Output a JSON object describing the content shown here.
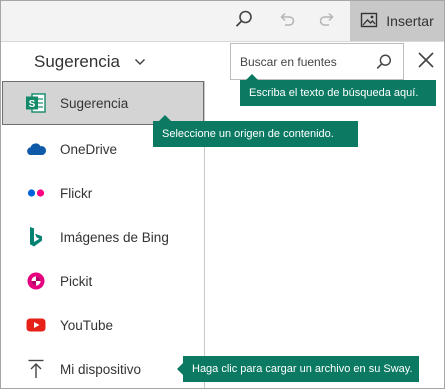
{
  "toolbar": {
    "insert_label": "Insertar",
    "icons": [
      "search-icon",
      "undo-icon",
      "redo-icon",
      "image-icon"
    ]
  },
  "source_dropdown": {
    "selected": "Sugerencia"
  },
  "search": {
    "placeholder": "Buscar en fuentes"
  },
  "menu": {
    "items": [
      {
        "label": "Sugerencia",
        "icon": "sway-suggestion-icon",
        "selected": true
      },
      {
        "label": "OneDrive",
        "icon": "onedrive-icon"
      },
      {
        "label": "Flickr",
        "icon": "flickr-icon"
      },
      {
        "label": "Imágenes de Bing",
        "icon": "bing-icon"
      },
      {
        "label": "Pickit",
        "icon": "pickit-icon"
      },
      {
        "label": "YouTube",
        "icon": "youtube-icon"
      },
      {
        "label": "Mi dispositivo",
        "icon": "upload-icon"
      }
    ]
  },
  "tooltips": {
    "search": "Escriba el texto de búsqueda aquí.",
    "source": "Seleccione un origen de contenido.",
    "upload": "Haga clic para cargar un archivo en su Sway."
  },
  "colors": {
    "tooltip_bg": "#0c7a63",
    "sway_green": "#138a6a",
    "onedrive_blue": "#0f5aa8",
    "flickr_blue": "#0063dc",
    "flickr_pink": "#ff0084",
    "bing_teal": "#008373",
    "pickit_pink": "#e6007e",
    "youtube_red": "#e62117",
    "toolbar_bg": "#f3f3f3",
    "insert_bg": "#c8c8c8",
    "selected_bg": "#d4d4d4"
  }
}
